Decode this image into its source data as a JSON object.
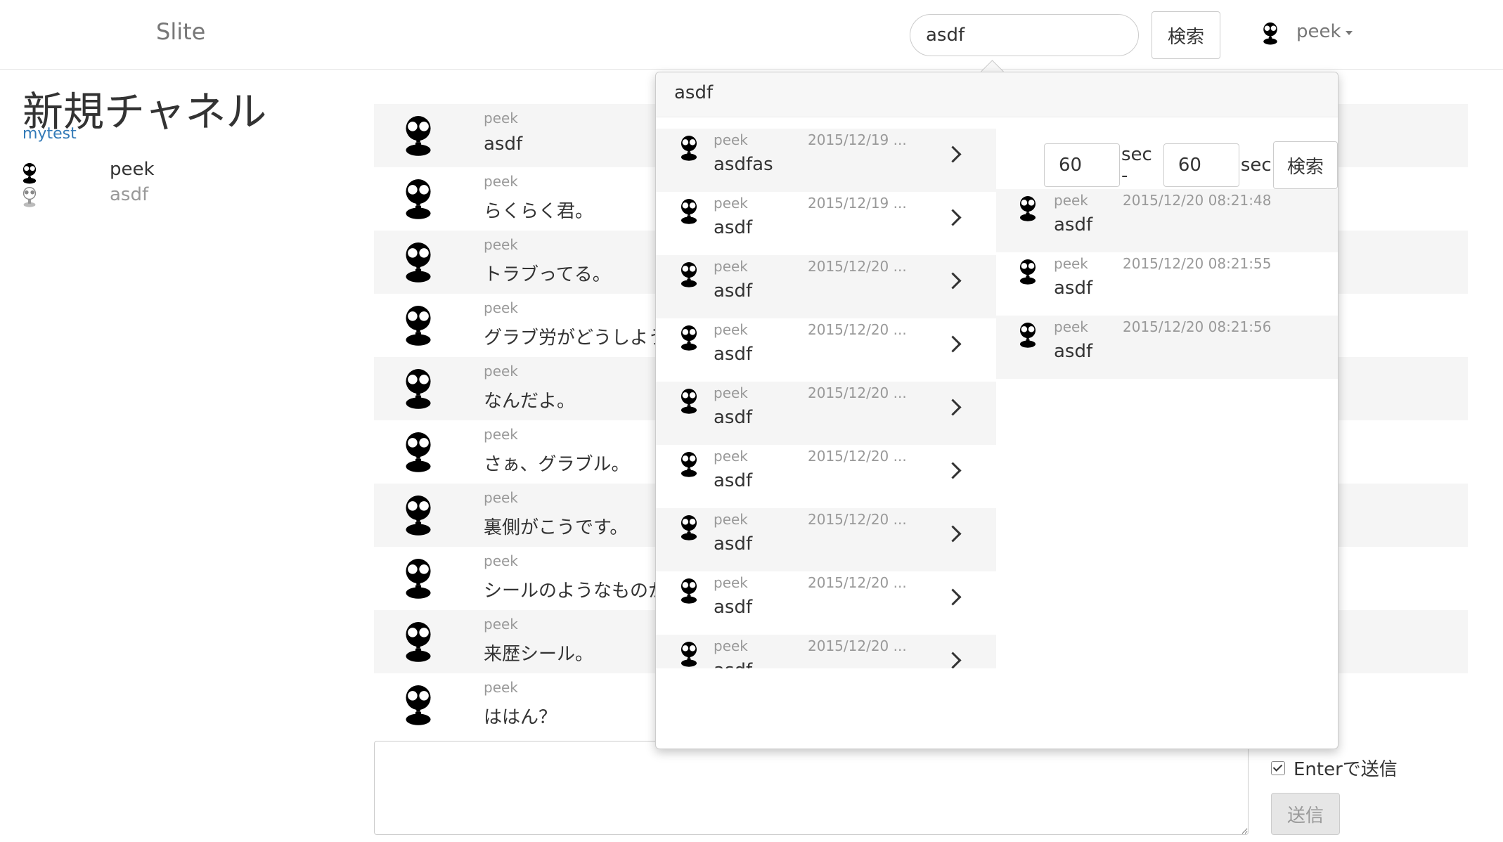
{
  "navbar": {
    "brand": "Slite",
    "search_value": "asdf",
    "search_button": "検索",
    "user_name": "peek"
  },
  "sidebar": {
    "channel_title": "新規チャネル",
    "channel_sub": "mytest",
    "members": [
      {
        "name": "peek",
        "status": "online"
      },
      {
        "name": "asdf",
        "status": "offline"
      }
    ]
  },
  "messages": [
    {
      "author": "peek",
      "text": "asdf"
    },
    {
      "author": "peek",
      "text": "らくらく君。"
    },
    {
      "author": "peek",
      "text": "トラブってる。"
    },
    {
      "author": "peek",
      "text": "グラブ労がどうしよう"
    },
    {
      "author": "peek",
      "text": "なんだよ。"
    },
    {
      "author": "peek",
      "text": "さぁ、グラブル。"
    },
    {
      "author": "peek",
      "text": "裏側がこうです。"
    },
    {
      "author": "peek",
      "text": "シールのようなものか"
    },
    {
      "author": "peek",
      "text": "来歴シール。"
    },
    {
      "author": "peek",
      "text": "ははん？"
    }
  ],
  "composer": {
    "enter_to_send_label": "Enterで送信",
    "enter_to_send_checked": true,
    "send_button": "送信"
  },
  "search_popover": {
    "query": "asdf",
    "results": [
      {
        "author": "peek",
        "date": "2015/12/19 ...",
        "text": "asdfas"
      },
      {
        "author": "peek",
        "date": "2015/12/19 ...",
        "text": "asdf"
      },
      {
        "author": "peek",
        "date": "2015/12/20 ...",
        "text": "asdf"
      },
      {
        "author": "peek",
        "date": "2015/12/20 ...",
        "text": "asdf"
      },
      {
        "author": "peek",
        "date": "2015/12/20 ...",
        "text": "asdf"
      },
      {
        "author": "peek",
        "date": "2015/12/20 ...",
        "text": "asdf"
      },
      {
        "author": "peek",
        "date": "2015/12/20 ...",
        "text": "asdf"
      },
      {
        "author": "peek",
        "date": "2015/12/20 ...",
        "text": "asdf"
      },
      {
        "author": "peek",
        "date": "2015/12/20 ...",
        "text": "asdf"
      }
    ],
    "range": {
      "before_value": "60",
      "before_unit": "sec -",
      "after_value": "60",
      "after_unit": "sec",
      "button": "検索"
    },
    "context": [
      {
        "author": "peek",
        "date": "2015/12/20 08:21:48",
        "text": "asdf"
      },
      {
        "author": "peek",
        "date": "2015/12/20 08:21:55",
        "text": "asdf"
      },
      {
        "author": "peek",
        "date": "2015/12/20 08:21:56",
        "text": "asdf"
      }
    ]
  }
}
